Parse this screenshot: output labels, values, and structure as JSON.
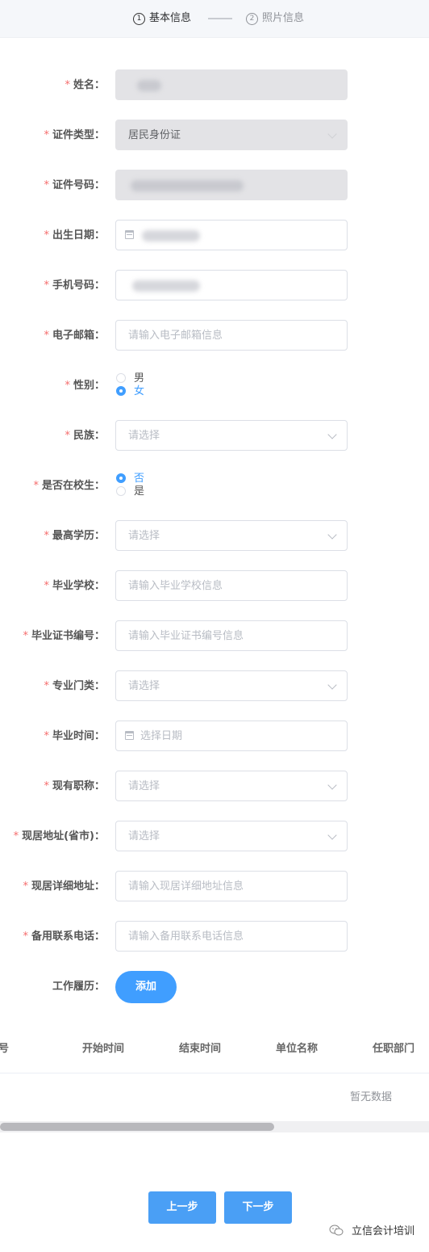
{
  "steps": [
    {
      "num": "1",
      "label": "基本信息"
    },
    {
      "num": "2",
      "label": "照片信息"
    }
  ],
  "form": {
    "name": {
      "label": "姓名："
    },
    "id_type": {
      "label": "证件类型：",
      "value": "居民身份证"
    },
    "id_number": {
      "label": "证件号码："
    },
    "birth_date": {
      "label": "出生日期："
    },
    "phone": {
      "label": "手机号码："
    },
    "email": {
      "label": "电子邮箱：",
      "placeholder": "请输入电子邮箱信息"
    },
    "gender": {
      "label": "性别：",
      "options": [
        "男",
        "女"
      ],
      "selected": "女"
    },
    "ethnicity": {
      "label": "民族：",
      "placeholder": "请选择"
    },
    "is_student": {
      "label": "是否在校生：",
      "options": [
        "否",
        "是"
      ],
      "selected": "否"
    },
    "education": {
      "label": "最高学历：",
      "placeholder": "请选择"
    },
    "school": {
      "label": "毕业学校：",
      "placeholder": "请输入毕业学校信息"
    },
    "cert_no": {
      "label": "毕业证书编号：",
      "placeholder": "请输入毕业证书编号信息"
    },
    "major": {
      "label": "专业门类：",
      "placeholder": "请选择"
    },
    "grad_time": {
      "label": "毕业时间：",
      "placeholder": "选择日期"
    },
    "title": {
      "label": "现有职称：",
      "placeholder": "请选择"
    },
    "address_region": {
      "label": "现居地址(省市)：",
      "placeholder": "请选择"
    },
    "address_detail": {
      "label": "现居详细地址：",
      "placeholder": "请输入现居详细地址信息"
    },
    "backup_phone": {
      "label": "备用联系电话：",
      "placeholder": "请输入备用联系电话信息"
    },
    "work_history": {
      "label": "工作履历：",
      "add_label": "添加"
    }
  },
  "required_mark": "*",
  "table": {
    "columns": [
      "号",
      "开始时间",
      "结束时间",
      "单位名称",
      "任职部门"
    ],
    "empty_text": "暂无数据"
  },
  "footer": {
    "prev_label": "上一步",
    "next_label": "下一步"
  },
  "watermark": {
    "text": "立信会计培训",
    "icon": "wechat-icon"
  },
  "colors": {
    "accent": "#409eff",
    "required": "#f56c6c",
    "disabled_bg": "#e3e3e6"
  }
}
